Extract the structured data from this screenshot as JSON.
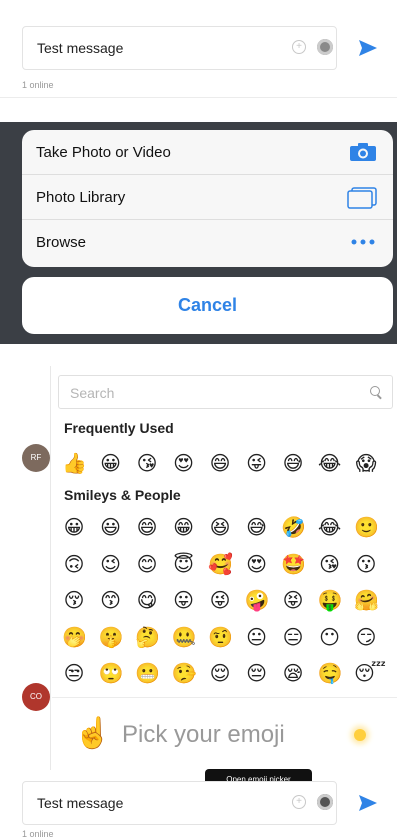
{
  "top_composer": {
    "message": "Test message",
    "online": "1 online",
    "attach_icon": "plus-circle-icon",
    "emoji_icon": "emoji-icon",
    "send_icon": "send-arrow-icon"
  },
  "action_sheet": {
    "items": [
      {
        "label": "Take Photo or Video",
        "icon": "camera-icon"
      },
      {
        "label": "Photo Library",
        "icon": "photo-library-icon"
      },
      {
        "label": "Browse",
        "icon": "ellipsis-icon"
      }
    ],
    "cancel_label": "Cancel",
    "accent": "#2f83e6"
  },
  "emoji_picker": {
    "search_placeholder": "Search",
    "sections": [
      {
        "title": "Frequently Used"
      },
      {
        "title": "Smileys & People"
      }
    ],
    "frequently_used": [
      "👍",
      "😀",
      "😘",
      "😍",
      "😄",
      "😜",
      "😅",
      "😂",
      "😱"
    ],
    "smileys_rows": [
      [
        "😀",
        "😃",
        "😄",
        "😁",
        "😆",
        "😅",
        "🤣",
        "😂",
        "🙂"
      ],
      [
        "🙃",
        "😉",
        "😊",
        "😇",
        "🥰",
        "😍",
        "🤩",
        "😘",
        "😗"
      ],
      [
        "😚",
        "😙",
        "😋",
        "😛",
        "😜",
        "🤪",
        "😝",
        "🤑",
        "🤗"
      ],
      [
        "🤭",
        "🤫",
        "🤔",
        "🤐",
        "🤨",
        "😐",
        "😑",
        "😶",
        "😏"
      ],
      [
        "😒",
        "🙄",
        "😬",
        "🤥",
        "😌",
        "😔",
        "😪",
        "🤤",
        "😴"
      ]
    ],
    "preview_emoji": "☝️",
    "preview_text": "Pick your emoji"
  },
  "avatars": [
    {
      "initials": "RF",
      "color": "#7d6a5e"
    },
    {
      "initials": "CO",
      "color": "#b0362c"
    }
  ],
  "tooltip": "Open emoji picker",
  "bottom_composer": {
    "message": "Test message",
    "online": "1 online"
  }
}
